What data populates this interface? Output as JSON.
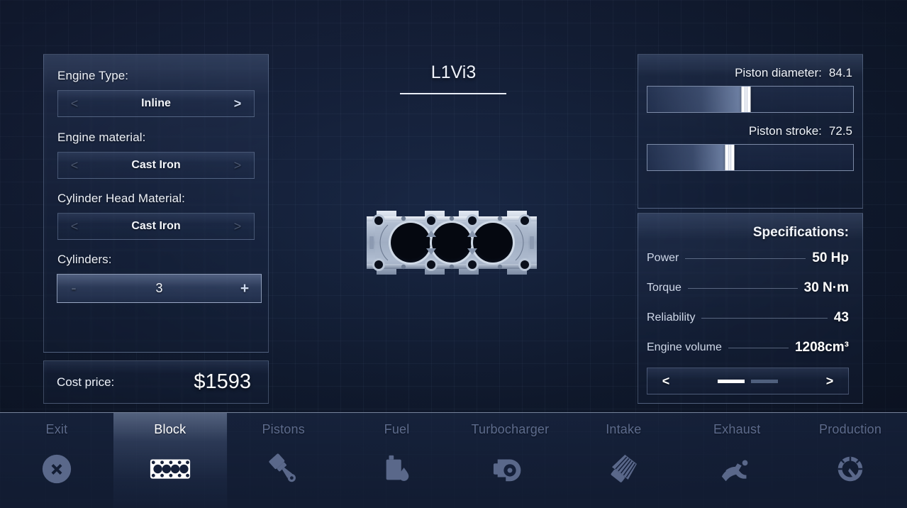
{
  "engine": {
    "title": "L1Vi3"
  },
  "left_panel": {
    "fields": [
      {
        "label": "Engine Type:",
        "name": "engine-type",
        "prev": "<",
        "next": ">",
        "value": "Inline",
        "prev_enabled": false,
        "next_enabled": true,
        "highlight": false
      },
      {
        "label": "Engine material:",
        "name": "engine-material",
        "prev": "<",
        "next": ">",
        "value": "Cast Iron",
        "prev_enabled": false,
        "next_enabled": false,
        "highlight": false
      },
      {
        "label": "Cylinder Head Material:",
        "name": "cylinder-head-material",
        "prev": "<",
        "next": ">",
        "value": "Cast Iron",
        "prev_enabled": false,
        "next_enabled": false,
        "highlight": false
      },
      {
        "label": "Cylinders:",
        "name": "cylinders",
        "prev": "-",
        "next": "+",
        "value": "3",
        "prev_enabled": false,
        "next_enabled": true,
        "highlight": true
      }
    ]
  },
  "cost": {
    "label": "Cost price:",
    "value": "$1593"
  },
  "sliders": [
    {
      "name": "piston-diameter",
      "label": "Piston diameter:",
      "value": "84.1",
      "percent": 48
    },
    {
      "name": "piston-stroke",
      "label": "Piston stroke:",
      "value": "72.5",
      "percent": 40
    }
  ],
  "specifications": {
    "title": "Specifications:",
    "rows": [
      {
        "name": "Power",
        "value": "50 Hp"
      },
      {
        "name": "Torque",
        "value": "30 N·m"
      },
      {
        "name": "Reliability",
        "value": "43"
      },
      {
        "name": "Engine volume",
        "value": "1208cm³"
      }
    ],
    "pager": {
      "prev": "<",
      "next": ">",
      "pages": 2,
      "active_page": 1
    }
  },
  "nav": {
    "items": [
      {
        "label": "Exit",
        "icon": "exit-icon",
        "active": false
      },
      {
        "label": "Block",
        "icon": "engine-block-icon",
        "active": true
      },
      {
        "label": "Pistons",
        "icon": "piston-icon",
        "active": false
      },
      {
        "label": "Fuel",
        "icon": "fuel-icon",
        "active": false
      },
      {
        "label": "Turbocharger",
        "icon": "turbocharger-icon",
        "active": false
      },
      {
        "label": "Intake",
        "icon": "air-filter-icon",
        "active": false
      },
      {
        "label": "Exhaust",
        "icon": "exhaust-icon",
        "active": false
      },
      {
        "label": "Production",
        "icon": "gauge-icon",
        "active": false
      }
    ]
  },
  "colors": {
    "background": "#101a2e",
    "panel_border": "#a8bcde",
    "accent_white": "#ffffff",
    "text_dim": "#5d6b8c",
    "metal_light": "#c9d3e2"
  }
}
